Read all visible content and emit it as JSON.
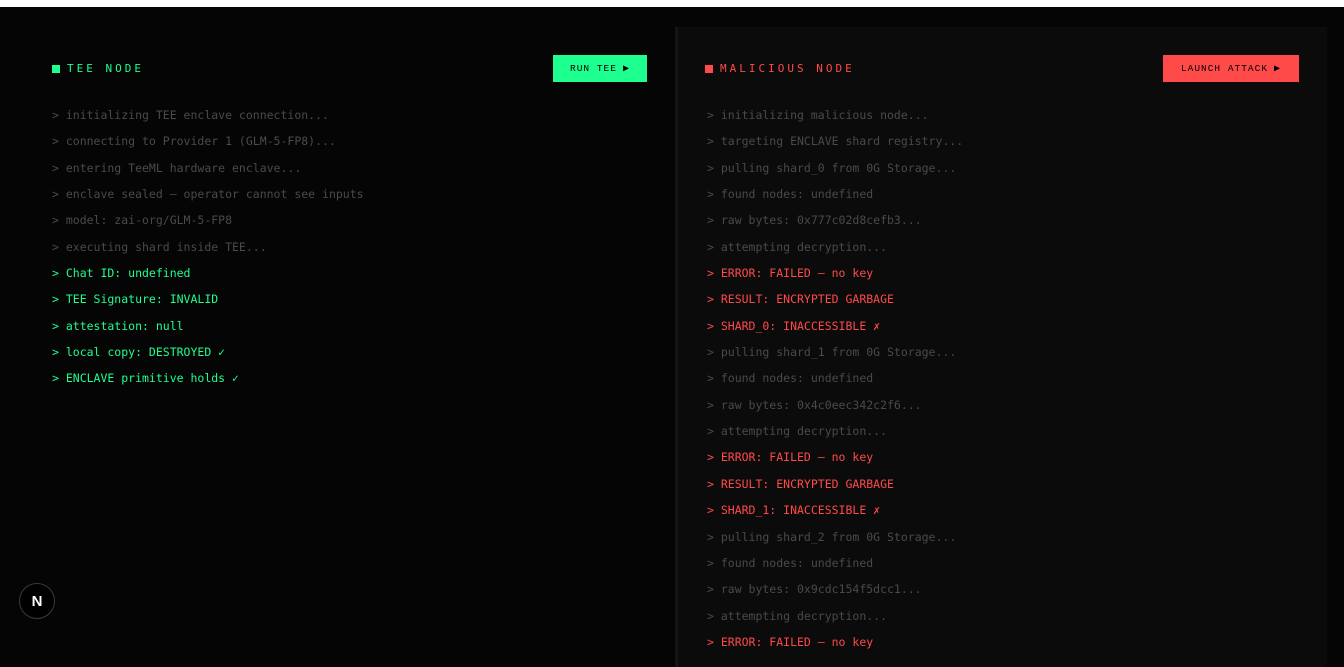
{
  "colors": {
    "accent_green": "#1dff8f",
    "accent_red": "#ff4a4a",
    "dim_text": "#4a4a4a"
  },
  "left_panel": {
    "title": "TEE NODE",
    "button_label": "RUN TEE",
    "button_icon": "play-icon",
    "log": [
      {
        "text": "> initializing TEE enclave connection...",
        "kind": "dim"
      },
      {
        "text": "> connecting to Provider 1 (GLM-5-FP8)...",
        "kind": "dim"
      },
      {
        "text": "> entering TeeML hardware enclave...",
        "kind": "dim"
      },
      {
        "text": "> enclave sealed — operator cannot see inputs",
        "kind": "dim"
      },
      {
        "text": "> model: zai-org/GLM-5-FP8",
        "kind": "dim"
      },
      {
        "text": "> executing shard inside TEE...",
        "kind": "dim"
      },
      {
        "text": "> Chat ID: undefined",
        "kind": "ok"
      },
      {
        "text": "> TEE Signature: INVALID",
        "kind": "ok"
      },
      {
        "text": "> attestation: null",
        "kind": "ok"
      },
      {
        "text": "> local copy: DESTROYED ✓",
        "kind": "ok"
      },
      {
        "text": "> ENCLAVE primitive holds ✓",
        "kind": "ok"
      }
    ]
  },
  "right_panel": {
    "title": "MALICIOUS NODE",
    "button_label": "LAUNCH ATTACK",
    "button_icon": "play-icon",
    "log": [
      {
        "text": "> initializing malicious node...",
        "kind": "dim"
      },
      {
        "text": "> targeting ENCLAVE shard registry...",
        "kind": "dim"
      },
      {
        "text": "> pulling shard_0 from 0G Storage...",
        "kind": "dim"
      },
      {
        "text": "> found nodes: undefined",
        "kind": "dim"
      },
      {
        "text": "> raw bytes: 0x777c02d8cefb3...",
        "kind": "dim"
      },
      {
        "text": "> attempting decryption...",
        "kind": "dim"
      },
      {
        "text": "> ERROR: FAILED — no key",
        "kind": "err"
      },
      {
        "text": "> RESULT: ENCRYPTED GARBAGE",
        "kind": "err"
      },
      {
        "text": "> SHARD_0: INACCESSIBLE ✗",
        "kind": "err"
      },
      {
        "text": "> pulling shard_1 from 0G Storage...",
        "kind": "dim"
      },
      {
        "text": "> found nodes: undefined",
        "kind": "dim"
      },
      {
        "text": "> raw bytes: 0x4c0eec342c2f6...",
        "kind": "dim"
      },
      {
        "text": "> attempting decryption...",
        "kind": "dim"
      },
      {
        "text": "> ERROR: FAILED — no key",
        "kind": "err"
      },
      {
        "text": "> RESULT: ENCRYPTED GARBAGE",
        "kind": "err"
      },
      {
        "text": "> SHARD_1: INACCESSIBLE ✗",
        "kind": "err"
      },
      {
        "text": "> pulling shard_2 from 0G Storage...",
        "kind": "dim"
      },
      {
        "text": "> found nodes: undefined",
        "kind": "dim"
      },
      {
        "text": "> raw bytes: 0x9cdc154f5dcc1...",
        "kind": "dim"
      },
      {
        "text": "> attempting decryption...",
        "kind": "dim"
      },
      {
        "text": "> ERROR: FAILED — no key",
        "kind": "err"
      }
    ]
  },
  "badge": {
    "letter": "N",
    "icon": "nextjs-logo-icon"
  }
}
